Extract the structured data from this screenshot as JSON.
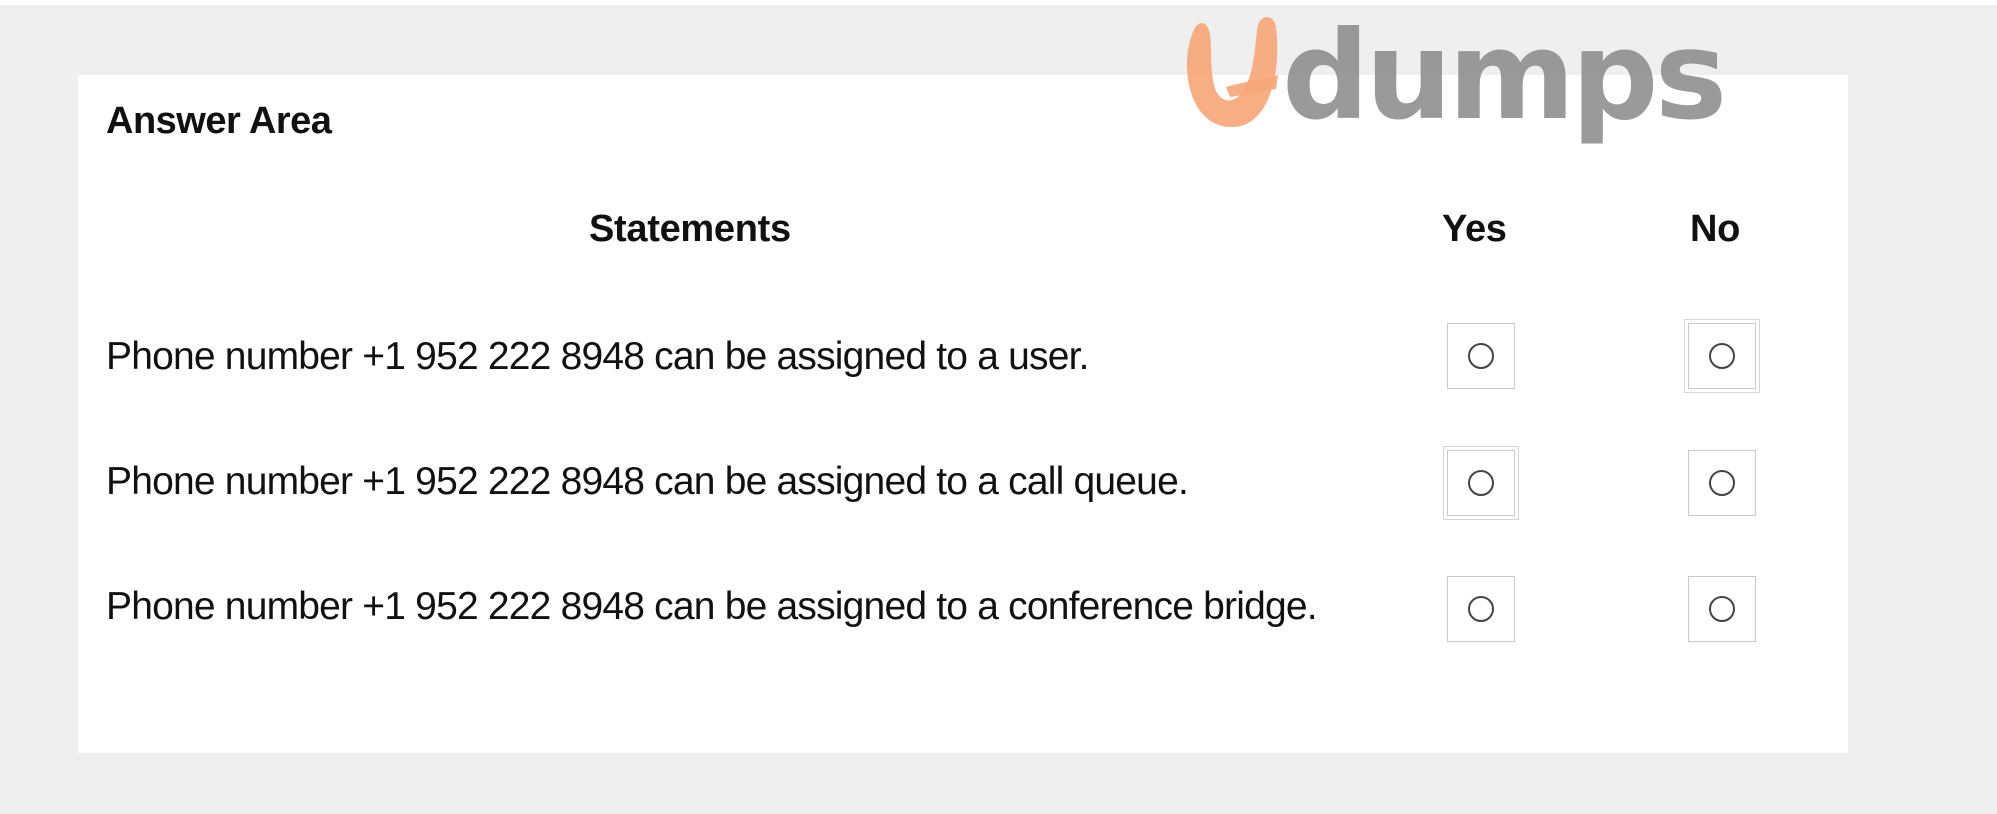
{
  "watermark": {
    "brand": "dumps",
    "accent_color": "#f6a77a",
    "text_color": "#8d8d8d"
  },
  "answer_area": {
    "title": "Answer Area",
    "headers": {
      "statements": "Statements",
      "yes": "Yes",
      "no": "No"
    },
    "rows": [
      {
        "statement": "Phone number +1 952 222 8948 can be assigned to a user.",
        "yes_selected": false,
        "no_selected": false
      },
      {
        "statement": "Phone number +1 952 222 8948 can be assigned to a call queue.",
        "yes_selected": false,
        "no_selected": false
      },
      {
        "statement": "Phone number +1 952 222 8948 can be assigned to a conference bridge.",
        "yes_selected": false,
        "no_selected": false
      }
    ]
  },
  "colors": {
    "page_background": "#efefef",
    "panel_background": "#ffffff",
    "text": "#111111",
    "radio_border": "#c9c9c9"
  }
}
